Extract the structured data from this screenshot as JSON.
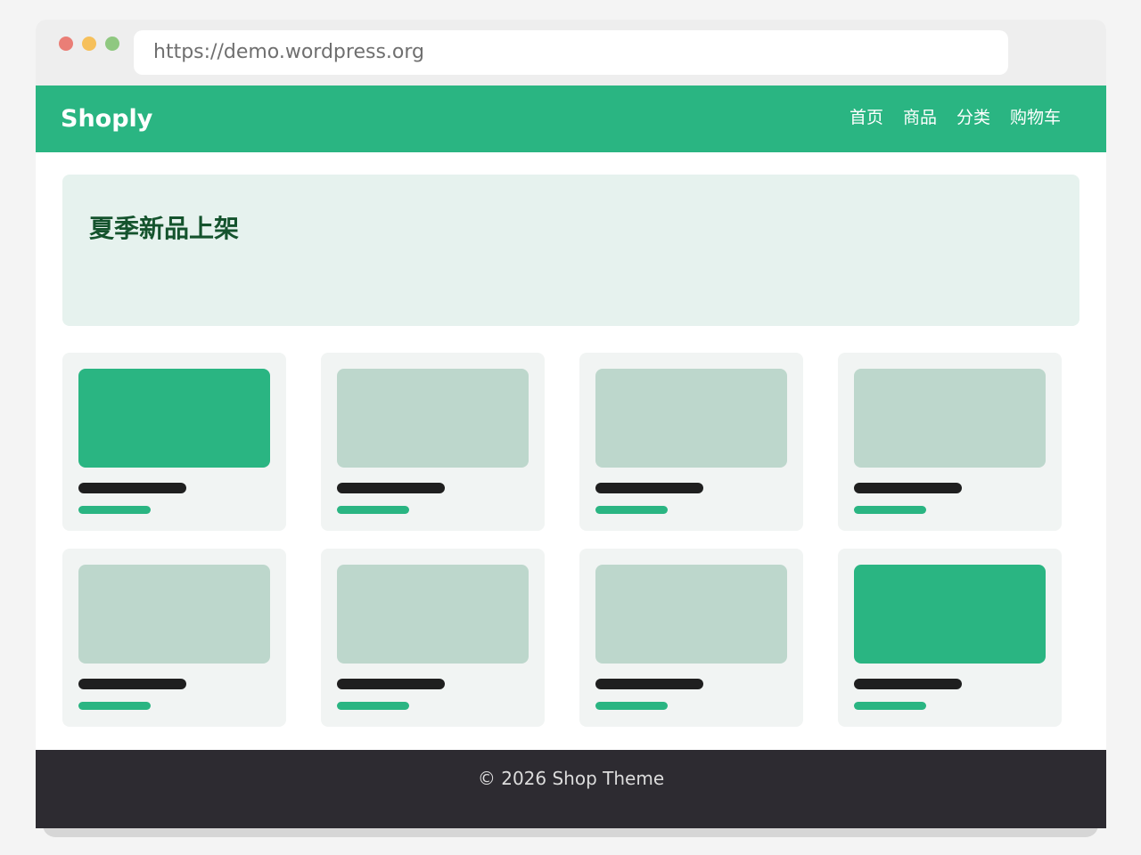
{
  "browser": {
    "url": "https://demo.wordpress.org"
  },
  "header": {
    "brand": "Shoply",
    "nav": [
      {
        "label": "首页"
      },
      {
        "label": "商品"
      },
      {
        "label": "分类"
      },
      {
        "label": "购物车"
      }
    ]
  },
  "hero": {
    "title": "夏季新品上架"
  },
  "colors": {
    "accent": "#2ab582",
    "image_placeholder": "#bdd7cc",
    "hero_background": "#e6f2ee",
    "footer_background": "#2d2b31"
  },
  "products": [
    {
      "image_style": "featured"
    },
    {
      "image_style": "placeholder"
    },
    {
      "image_style": "placeholder"
    },
    {
      "image_style": "placeholder"
    },
    {
      "image_style": "placeholder"
    },
    {
      "image_style": "placeholder"
    },
    {
      "image_style": "placeholder"
    },
    {
      "image_style": "featured"
    }
  ],
  "footer": {
    "text": "© 2026 Shop Theme"
  }
}
